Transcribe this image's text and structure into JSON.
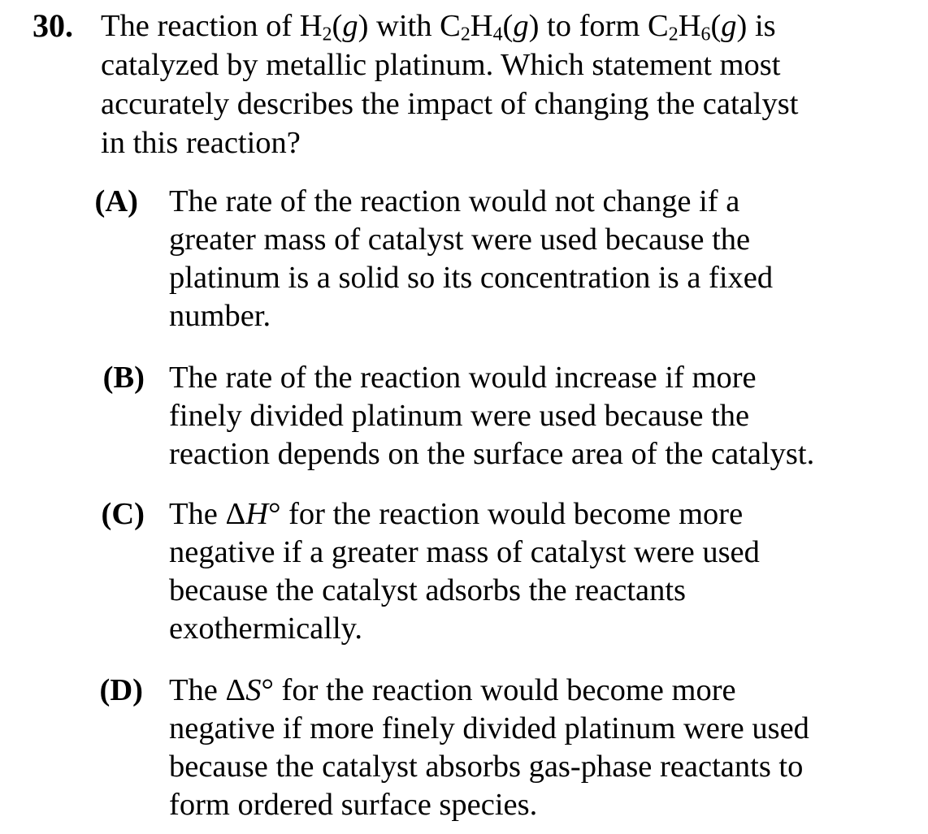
{
  "question": {
    "number": "30.",
    "stem": {
      "line1": {
        "p1": "The reaction of H",
        "sub1": "2",
        "p2": "(",
        "g1": "g",
        "p3": ") with C",
        "sub2": "2",
        "p4": "H",
        "sub3": "4",
        "p5": "(",
        "g2": "g",
        "p6": ") to form C",
        "sub4": "2",
        "p7": "H",
        "sub5": "6",
        "p8": "(",
        "g3": "g",
        "p9": ") is"
      },
      "line2": "catalyzed by metallic platinum.  Which statement most",
      "line3": "accurately describes the impact of changing the catalyst",
      "line4": "in this reaction?"
    },
    "choices": [
      {
        "letter": "(A)",
        "lines": [
          "The rate of the reaction would not change if a",
          "greater mass of catalyst were used because the",
          "platinum is a solid so its concentration is a fixed",
          "number."
        ]
      },
      {
        "letter": "(B)",
        "lines": [
          "The rate of the reaction would increase if more",
          "finely divided platinum were used because the",
          "reaction depends on the surface area of the catalyst."
        ]
      },
      {
        "letter": "(C)",
        "first_line": {
          "pre": "The Δ",
          "var": "H",
          "post": "° for the reaction would become more"
        },
        "lines": [
          "negative if a greater mass of catalyst were used",
          "because the catalyst adsorbs the reactants",
          "exothermically."
        ]
      },
      {
        "letter": "(D)",
        "first_line": {
          "pre": "The Δ",
          "var": "S",
          "post": "° for the reaction would become more"
        },
        "lines": [
          "negative if more finely divided platinum were used",
          "because the catalyst absorbs gas-phase reactants to",
          "form ordered surface species."
        ]
      }
    ]
  }
}
